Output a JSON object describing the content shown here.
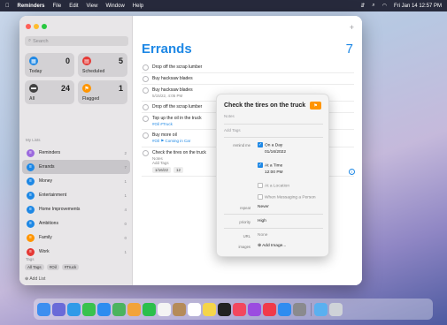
{
  "menubar": {
    "apple_icon": "apple-logo",
    "app": "Reminders",
    "items": [
      "File",
      "Edit",
      "View",
      "Window",
      "Help"
    ],
    "status_icons": [
      "control-center-icon",
      "search-icon",
      "wifi-icon"
    ],
    "clock": "Fri Jan 14 12:57 PM"
  },
  "sidebar": {
    "search_placeholder": "Search",
    "smart_lists": [
      {
        "label": "Today",
        "count": "0",
        "color": "#1e88e5"
      },
      {
        "label": "Scheduled",
        "count": "5",
        "color": "#e53935"
      },
      {
        "label": "All",
        "count": "24",
        "color": "#424242"
      },
      {
        "label": "Flagged",
        "count": "1",
        "color": "#ff9500"
      }
    ],
    "section_title": "My Lists",
    "lists": [
      {
        "label": "Reminders",
        "count": "2",
        "color": "#9c6ade"
      },
      {
        "label": "Errands",
        "count": "7",
        "color": "#1e88e5"
      },
      {
        "label": "Money",
        "count": "1",
        "color": "#1e88e5"
      },
      {
        "label": "Entertainment",
        "count": "1",
        "color": "#1e88e5"
      },
      {
        "label": "Home Improvements",
        "count": "4",
        "color": "#1e88e5"
      },
      {
        "label": "Ambitions",
        "count": "0",
        "color": "#1e88e5"
      },
      {
        "label": "Family",
        "count": "0",
        "color": "#ff9500"
      },
      {
        "label": "Work",
        "count": "1",
        "color": "#e53935"
      }
    ],
    "tags_title": "Tags",
    "tags": [
      "All Tags",
      "#Oil",
      "#Truck"
    ],
    "add_list": "Add List"
  },
  "main": {
    "title": "Errands",
    "count": "7",
    "reminders": [
      {
        "title": "Drop off the scrap lumber"
      },
      {
        "title": "Buy hacksaw blades"
      },
      {
        "title": "Buy hacksaw blades",
        "sub": "5/15/22, 4:05 PM"
      },
      {
        "title": "Drop off the scrap lumber"
      },
      {
        "title": "Top up the oil in the truck",
        "hash": "#Oil #Truck"
      },
      {
        "title": "Buy more oil",
        "hash": "#Oil  ⚑ Coming in Car"
      },
      {
        "title": "Check the tires on the truck",
        "sub": "Notes\nAdd Tags",
        "chips": [
          "1/16/22",
          "12"
        ]
      }
    ]
  },
  "popover": {
    "title": "Check the tires on the truck",
    "notes": "Notes",
    "tags": "Add Tags",
    "remind_label": "remind me",
    "on_day": "On a Day",
    "date": "01/16/2022",
    "at_time": "At a Time",
    "time": "12:00 PM",
    "at_location": "At a Location",
    "when_messaging": "When Messaging a Person",
    "repeat_label": "repeat",
    "repeat": "Never",
    "priority_label": "priority",
    "priority": "High",
    "url_label": "URL",
    "url": "None",
    "images_label": "images",
    "add_image": "⊕ Add Image..."
  },
  "dock": {
    "icons": [
      {
        "name": "finder-icon",
        "color": "#3d8ef0"
      },
      {
        "name": "launchpad-icon",
        "color": "#6a6ad8"
      },
      {
        "name": "safari-icon",
        "color": "#2f9ae8"
      },
      {
        "name": "messages-icon",
        "color": "#39c24e"
      },
      {
        "name": "mail-icon",
        "color": "#2d8cf0"
      },
      {
        "name": "maps-icon",
        "color": "#4bb35f"
      },
      {
        "name": "photos-icon",
        "color": "#f2a33a"
      },
      {
        "name": "facetime-icon",
        "color": "#2bbf4c"
      },
      {
        "name": "calendar-icon",
        "color": "#f4f4f4"
      },
      {
        "name": "contacts-icon",
        "color": "#b58b5a"
      },
      {
        "name": "reminders-icon",
        "color": "#ffffff"
      },
      {
        "name": "notes-icon",
        "color": "#f5d54a"
      },
      {
        "name": "tv-icon",
        "color": "#222222"
      },
      {
        "name": "music-icon",
        "color": "#f2475e"
      },
      {
        "name": "podcasts-icon",
        "color": "#9b4ce0"
      },
      {
        "name": "news-icon",
        "color": "#f03a4a"
      },
      {
        "name": "appstore-icon",
        "color": "#2f8cf0"
      },
      {
        "name": "settings-icon",
        "color": "#8a8a8e"
      },
      {
        "name": "downloads-folder-icon",
        "color": "#5ab0f0"
      },
      {
        "name": "trash-icon",
        "color": "#cfd3d8"
      }
    ]
  }
}
